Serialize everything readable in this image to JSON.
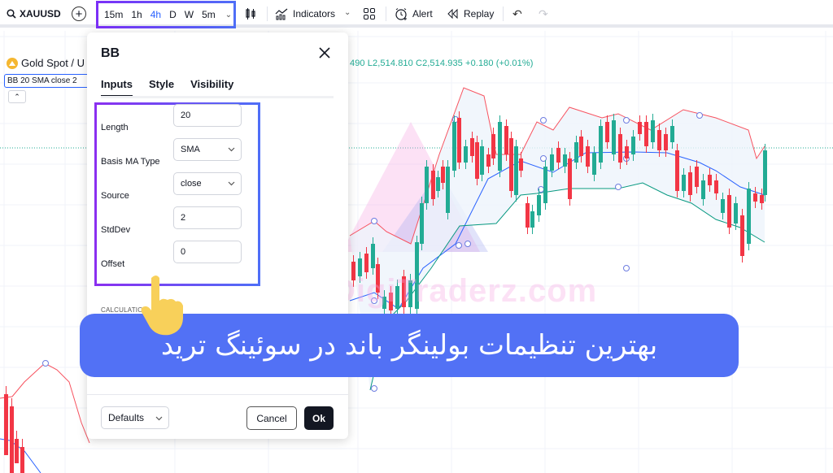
{
  "toolbar": {
    "symbol": "XAUUSD",
    "timeframes": [
      "15m",
      "1h",
      "4h",
      "D",
      "W",
      "5m"
    ],
    "active_timeframe": "4h",
    "indicators_label": "Indicators",
    "alert_label": "Alert",
    "replay_label": "Replay"
  },
  "chart": {
    "instrument_title": "Gold Spot / U",
    "indicator_chip": "BB 20 SMA close 2",
    "ohlc_readout": "490  L2,514.810  C2,514.935  +0.180 (+0.01%)",
    "watermark": "DigiTraderz.com",
    "colors": {
      "up": "#22ab94",
      "down": "#f23645",
      "upper_band": "#f7525f",
      "basis": "#2962ff",
      "lower_band": "#089981",
      "band_fill": "#eef4fb"
    }
  },
  "dialog": {
    "title": "BB",
    "tabs": [
      {
        "label": "Inputs",
        "active": true
      },
      {
        "label": "Style",
        "active": false
      },
      {
        "label": "Visibility",
        "active": false
      }
    ],
    "inputs": [
      {
        "label": "Length",
        "value": "20",
        "type": "number"
      },
      {
        "label": "Basis MA Type",
        "value": "SMA",
        "type": "select"
      },
      {
        "label": "Source",
        "value": "close",
        "type": "select"
      },
      {
        "label": "StdDev",
        "value": "2",
        "type": "number"
      },
      {
        "label": "Offset",
        "value": "0",
        "type": "number"
      }
    ],
    "section_calculation": "CALCULATION",
    "defaults_label": "Defaults",
    "cancel_label": "Cancel",
    "ok_label": "Ok"
  },
  "banner": {
    "text": "بهترین تنظیمات بولینگر باند در سوئینگ ترید"
  }
}
